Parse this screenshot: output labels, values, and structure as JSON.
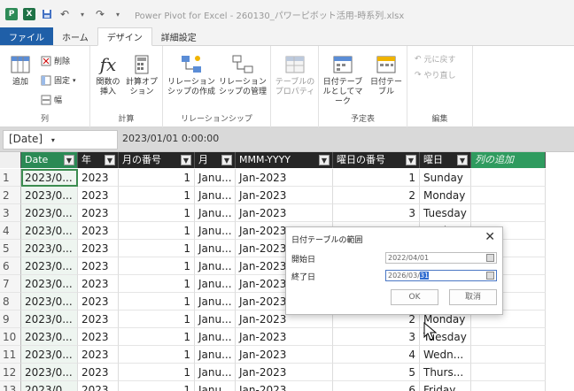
{
  "window": {
    "title": "Power Pivot for Excel - 260130_パワーピボット活用-時系列.xlsx"
  },
  "tabs": [
    {
      "label": "ファイル"
    },
    {
      "label": "ホーム"
    },
    {
      "label": "デザイン"
    },
    {
      "label": "詳細設定"
    }
  ],
  "ribbon": {
    "column_group": {
      "label": "列",
      "add_label": "追加",
      "delete_label": "削除",
      "freeze_label": "固定",
      "width_label": "幅"
    },
    "calc_group": {
      "label": "計算",
      "insert_function_label": "関数の挿入",
      "calc_options_label": "計算オプション"
    },
    "relation_group": {
      "label": "リレーションシップ",
      "create_label": "リレーションシップの作成",
      "manage_label": "リレーションシップの管理"
    },
    "table_props_label": "テーブルのプロパティ",
    "calendar_group": {
      "label": "予定表",
      "mark_label": "日付テーブルとしてマーク",
      "date_table_label": "日付テーブル"
    },
    "edit_group": {
      "label": "編集",
      "undo_label": "元に戻す",
      "redo_label": "やり直し"
    }
  },
  "formula_bar": {
    "name_box": "[Date]",
    "value": "2023/01/01 0:00:00"
  },
  "grid": {
    "headers": [
      "Date",
      "年",
      "月の番号",
      "月",
      "MMM-YYYY",
      "曜日の番号",
      "曜日",
      "列の追加"
    ],
    "rows": [
      {
        "n": "1",
        "date": "2023/0...",
        "year": "2023",
        "monthnum": "1",
        "month": "Janu...",
        "mmm": "Jan-2023",
        "daynum": "1",
        "day": "Sunday"
      },
      {
        "n": "2",
        "date": "2023/0...",
        "year": "2023",
        "monthnum": "1",
        "month": "Janu...",
        "mmm": "Jan-2023",
        "daynum": "2",
        "day": "Monday"
      },
      {
        "n": "3",
        "date": "2023/0...",
        "year": "2023",
        "monthnum": "1",
        "month": "Janu...",
        "mmm": "Jan-2023",
        "daynum": "3",
        "day": "Tuesday"
      },
      {
        "n": "4",
        "date": "2023/0...",
        "year": "2023",
        "monthnum": "1",
        "month": "Janu...",
        "mmm": "Jan-2023",
        "daynum": "4",
        "day": "Wedn..."
      },
      {
        "n": "5",
        "date": "2023/0...",
        "year": "2023",
        "monthnum": "1",
        "month": "Janu...",
        "mmm": "Jan-2023",
        "daynum": "",
        "day": ""
      },
      {
        "n": "6",
        "date": "2023/0...",
        "year": "2023",
        "monthnum": "1",
        "month": "Janu...",
        "mmm": "Jan-2023",
        "daynum": "",
        "day": ""
      },
      {
        "n": "7",
        "date": "2023/0...",
        "year": "2023",
        "monthnum": "1",
        "month": "Janu...",
        "mmm": "Jan-2023",
        "daynum": "",
        "day": ""
      },
      {
        "n": "8",
        "date": "2023/0...",
        "year": "2023",
        "monthnum": "1",
        "month": "Janu...",
        "mmm": "Jan-2023",
        "daynum": "",
        "day": ""
      },
      {
        "n": "9",
        "date": "2023/0...",
        "year": "2023",
        "monthnum": "1",
        "month": "Janu...",
        "mmm": "Jan-2023",
        "daynum": "2",
        "day": "Monday"
      },
      {
        "n": "10",
        "date": "2023/0...",
        "year": "2023",
        "monthnum": "1",
        "month": "Janu...",
        "mmm": "Jan-2023",
        "daynum": "3",
        "day": "Tuesday"
      },
      {
        "n": "11",
        "date": "2023/0...",
        "year": "2023",
        "monthnum": "1",
        "month": "Janu...",
        "mmm": "Jan-2023",
        "daynum": "4",
        "day": "Wedn..."
      },
      {
        "n": "12",
        "date": "2023/0...",
        "year": "2023",
        "monthnum": "1",
        "month": "Janu...",
        "mmm": "Jan-2023",
        "daynum": "5",
        "day": "Thurs..."
      },
      {
        "n": "13",
        "date": "2023/0...",
        "year": "2023",
        "monthnum": "1",
        "month": "Janu...",
        "mmm": "Jan-2023",
        "daynum": "6",
        "day": "Friday"
      }
    ]
  },
  "dialog": {
    "title": "日付テーブルの範囲",
    "start_label": "開始日",
    "start_value": "2022/04/01",
    "end_label": "終了日",
    "end_value_prefix": "2026/03/",
    "end_value_selected": "31",
    "ok_label": "OK",
    "cancel_label": "取消"
  },
  "colors": {
    "accent_green": "#2b8a55",
    "file_tab_blue": "#1f5fa8",
    "header_dark": "#262626"
  }
}
